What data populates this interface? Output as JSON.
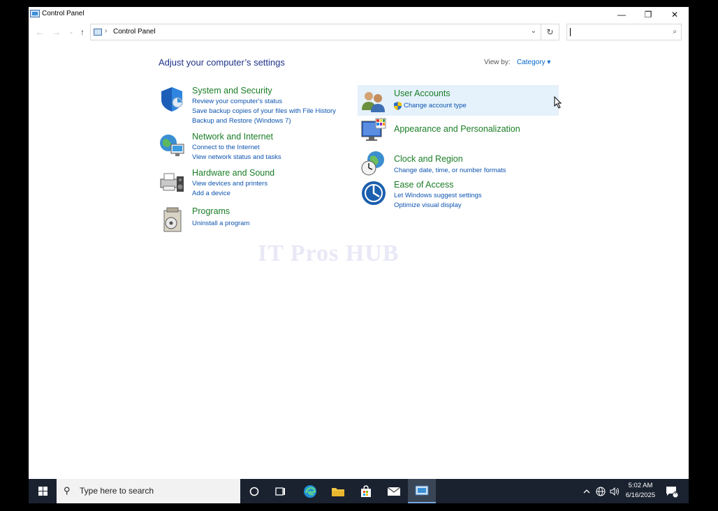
{
  "window": {
    "title": "Control Panel",
    "minimize": "—",
    "maximize": "❐",
    "close": "✕"
  },
  "nav": {
    "back": "←",
    "forward": "→",
    "recent": "⌄",
    "up": "↑",
    "separator": "›",
    "breadcrumb": "Control Panel",
    "dropdown": "⌄",
    "refresh": "↻",
    "search_placeholder": "",
    "search_icon": "⌕"
  },
  "content": {
    "heading": "Adjust your computer’s settings",
    "view_by_label": "View by:",
    "view_by_value": "Category ▾",
    "categories_left": [
      {
        "title": "System and Security",
        "icon": "shield-icon",
        "links": [
          "Review your computer's status",
          "Save backup copies of your files with File History",
          "Backup and Restore (Windows 7)"
        ]
      },
      {
        "title": "Network and Internet",
        "icon": "globe-network-icon",
        "links": [
          "Connect to the Internet",
          "View network status and tasks"
        ]
      },
      {
        "title": "Hardware and Sound",
        "icon": "printer-speaker-icon",
        "links": [
          "View devices and printers",
          "Add a device"
        ]
      },
      {
        "title": "Programs",
        "icon": "programs-disc-icon",
        "links": [
          "Uninstall a program"
        ]
      }
    ],
    "categories_right": [
      {
        "title": "User Accounts",
        "icon": "users-icon",
        "links": [
          "Change account type"
        ]
      },
      {
        "title": "Appearance and Personalization",
        "icon": "monitor-palette-icon",
        "links": []
      },
      {
        "title": "Clock and Region",
        "icon": "clock-globe-icon",
        "links": [
          "Change date, time, or number formats"
        ]
      },
      {
        "title": "Ease of Access",
        "icon": "ease-of-access-icon",
        "links": [
          "Let Windows suggest settings",
          "Optimize visual display"
        ]
      }
    ],
    "watermark": "IT Pros HUB"
  },
  "taskbar": {
    "search_text": "Type here to search",
    "time": "5:02 AM",
    "date": "6/16/2025",
    "notification_count": "1"
  },
  "colors": {
    "heading": "#1e3287",
    "category_title": "#1a7d26",
    "link": "#0d54b0",
    "hover": "#e5f1fb",
    "taskbar": "#1a2230"
  }
}
